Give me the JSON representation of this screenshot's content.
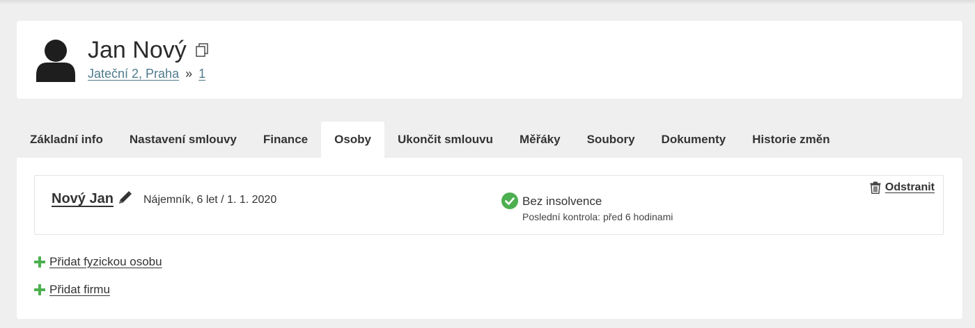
{
  "header": {
    "name": "Jan Nový",
    "breadcrumb": {
      "address": "Jateční 2, Praha",
      "separator": "»",
      "unit": "1"
    }
  },
  "tabs": [
    {
      "label": "Základní info",
      "active": false
    },
    {
      "label": "Nastavení smlouvy",
      "active": false
    },
    {
      "label": "Finance",
      "active": false
    },
    {
      "label": "Osoby",
      "active": true
    },
    {
      "label": "Ukončit smlouvu",
      "active": false
    },
    {
      "label": "Měřáky",
      "active": false
    },
    {
      "label": "Soubory",
      "active": false
    },
    {
      "label": "Dokumenty",
      "active": false
    },
    {
      "label": "Historie změn",
      "active": false
    }
  ],
  "person": {
    "name": "Nový Jan",
    "role": "Nájemník, 6 let / 1. 1. 2020",
    "insolvence": "Bez insolvence",
    "last_check": "Poslední kontrola: před 6 hodinami",
    "remove_label": "Odstranit"
  },
  "actions": {
    "add_person": "Přidat fyzickou osobu",
    "add_company": "Přidat firmu"
  },
  "colors": {
    "background": "#efefef",
    "card": "#ffffff",
    "link": "#4e7a8c",
    "success": "#4caf50",
    "text": "#333333"
  },
  "icons": {
    "avatar": "user-silhouette-icon",
    "copy": "copy-icon",
    "edit": "pencil-icon",
    "status": "check-circle-icon",
    "remove": "trash-icon",
    "add": "plus-icon"
  }
}
